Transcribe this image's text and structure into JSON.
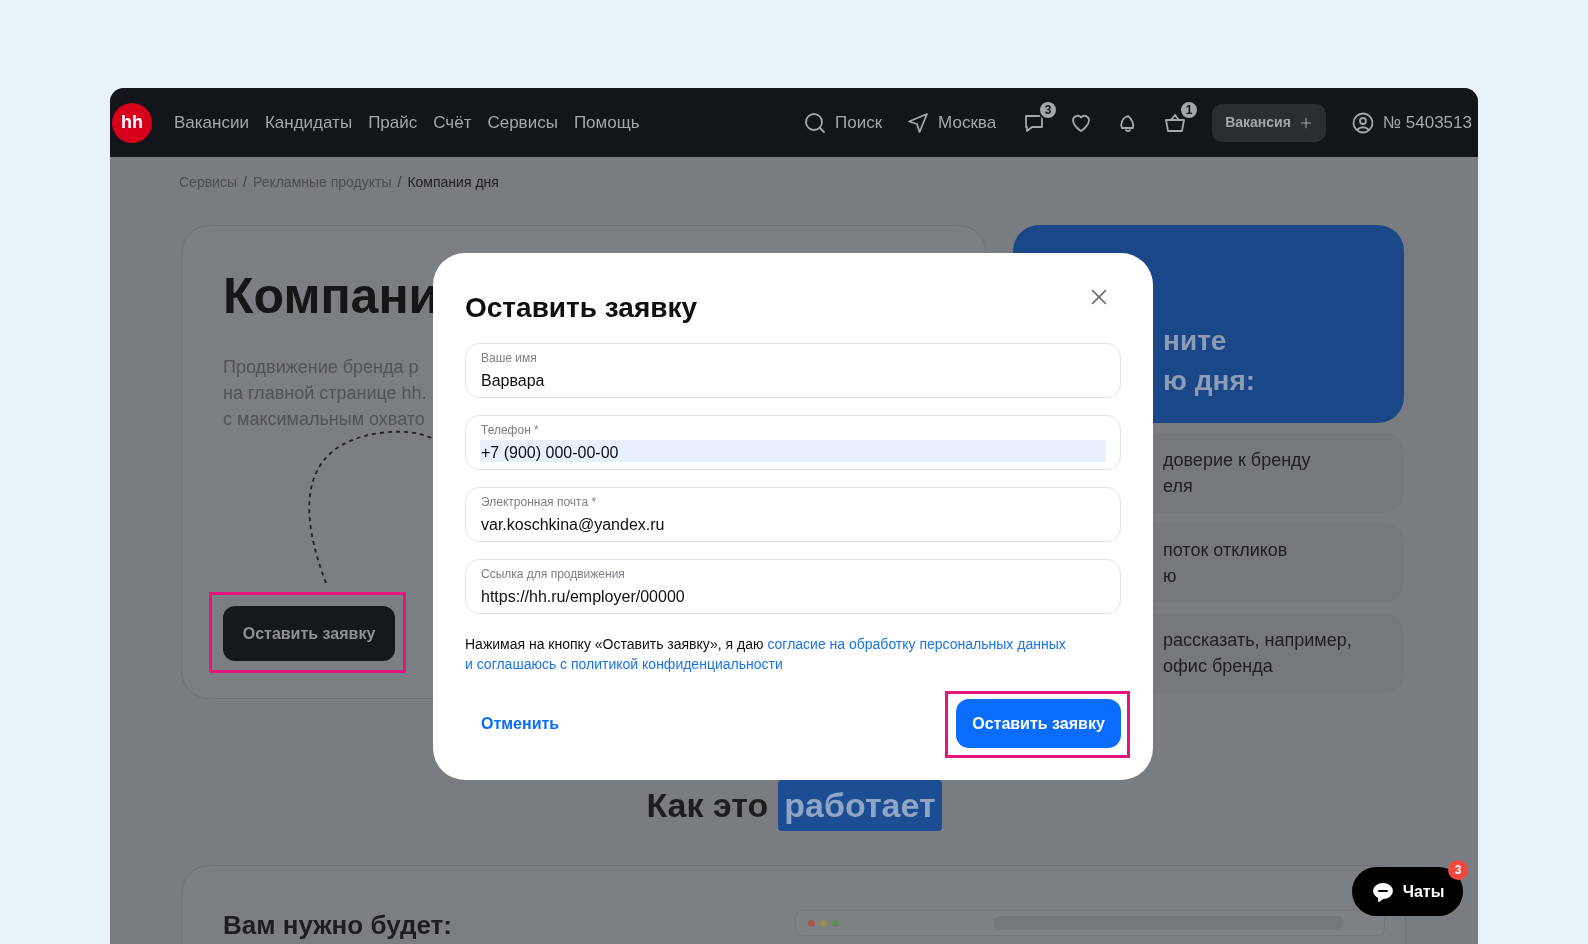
{
  "nav": {
    "logo": "hh",
    "links": [
      "Вакансии",
      "Кандидаты",
      "Прайс",
      "Счёт",
      "Сервисы",
      "Помощь"
    ],
    "search": "Поиск",
    "city": "Москва",
    "icons": [
      {
        "kind": "chat",
        "badge": "3"
      },
      {
        "kind": "heart"
      },
      {
        "kind": "bell"
      },
      {
        "kind": "cart",
        "badge": "1"
      }
    ],
    "create_button": "Вакансия",
    "account": "№ 5403513"
  },
  "breadcrumb_separator": "/",
  "breadcrumbs": [
    {
      "label": "Сервисы",
      "current": false
    },
    {
      "label": "Рекламные продукты",
      "current": false
    },
    {
      "label": "Компания дня",
      "current": true
    }
  ],
  "hero": {
    "title": "Компани",
    "description": [
      "Продвижение бренда р",
      "на главной странице hh.",
      "с максимальным охвато"
    ],
    "button": "Оставить заявку"
  },
  "promo": {
    "title_lines": [
      "ните",
      "ю дня:"
    ],
    "benefits": [
      [
        "доверие к бренду",
        "еля"
      ],
      [
        "поток откликов",
        "ю"
      ],
      [
        "рассказать, например,",
        "офис бренда"
      ]
    ]
  },
  "how_it_works": {
    "text": "Как это",
    "highlight": "работает"
  },
  "requirements": {
    "title": "Вам нужно будет:"
  },
  "modal": {
    "title": "Оставить заявку",
    "fields": [
      {
        "label": "Ваше имя",
        "value": "Варвара",
        "value_selected": false
      },
      {
        "label": "Телефон *",
        "value": "+7 (900) 000-00-00",
        "value_selected": true
      },
      {
        "label": "Электронная почта *",
        "value": "var.koschkina@yandex.ru",
        "value_selected": false
      },
      {
        "label": "Ссылка для продвижения",
        "value": "https://hh.ru/employer/00000",
        "value_selected": false
      }
    ],
    "consent": {
      "text": "Нажимая на кнопку «Оставить заявку», я даю",
      "links": [
        "согласие на обработку персональных данных",
        "и соглашаюсь с политикой конфиденциальности"
      ]
    },
    "cancel": "Отменить",
    "submit": "Оставить заявку"
  },
  "chats": {
    "label": "Чаты",
    "badge": "3"
  }
}
